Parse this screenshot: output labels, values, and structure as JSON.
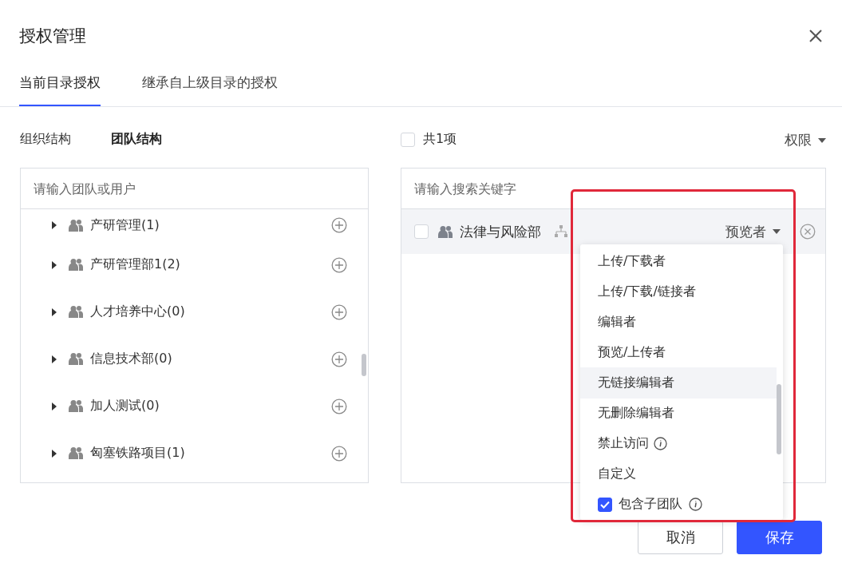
{
  "dialog": {
    "title": "授权管理"
  },
  "tabs": [
    {
      "label": "当前目录授权",
      "selected": true
    },
    {
      "label": "继承自上级目录的授权",
      "selected": false
    }
  ],
  "left": {
    "tabs": [
      {
        "label": "组织结构",
        "selected": false
      },
      {
        "label": "团队结构",
        "selected": true
      }
    ],
    "search": {
      "placeholder": "请输入团队或用户"
    },
    "tree": [
      {
        "label": "产研管理(1)",
        "expanded": false
      },
      {
        "label": "产研管理部1(2)",
        "expanded": false
      },
      {
        "label": "人才培养中心(0)",
        "expanded": false
      },
      {
        "label": "信息技术部(0)",
        "expanded": false
      },
      {
        "label": "加人测试(0)",
        "expanded": false
      },
      {
        "label": "匈塞铁路项目(1)",
        "expanded": false
      }
    ]
  },
  "right": {
    "select_all": {
      "label": "共1项",
      "checked": false
    },
    "permission_filter": "权限",
    "search": {
      "placeholder": "请输入搜索关键字"
    },
    "members": [
      {
        "name": "法律与风险部",
        "checked": false,
        "role": "预览者"
      }
    ]
  },
  "role_menu": {
    "options": [
      {
        "label": "上传/下载者",
        "highlighted": false,
        "info": false
      },
      {
        "label": "上传/下载/链接者",
        "highlighted": false,
        "info": false
      },
      {
        "label": "编辑者",
        "highlighted": false,
        "info": false
      },
      {
        "label": "预览/上传者",
        "highlighted": false,
        "info": false
      },
      {
        "label": "无链接编辑者",
        "highlighted": true,
        "info": false
      },
      {
        "label": "无删除编辑者",
        "highlighted": false,
        "info": false
      },
      {
        "label": "禁止访问",
        "highlighted": false,
        "info": true
      }
    ],
    "custom": "自定义",
    "include_subteams": {
      "label": "包含子团队",
      "checked": true
    }
  },
  "buttons": [
    {
      "label": "取消",
      "kind": "secondary"
    },
    {
      "label": "保存",
      "kind": "primary"
    }
  ]
}
